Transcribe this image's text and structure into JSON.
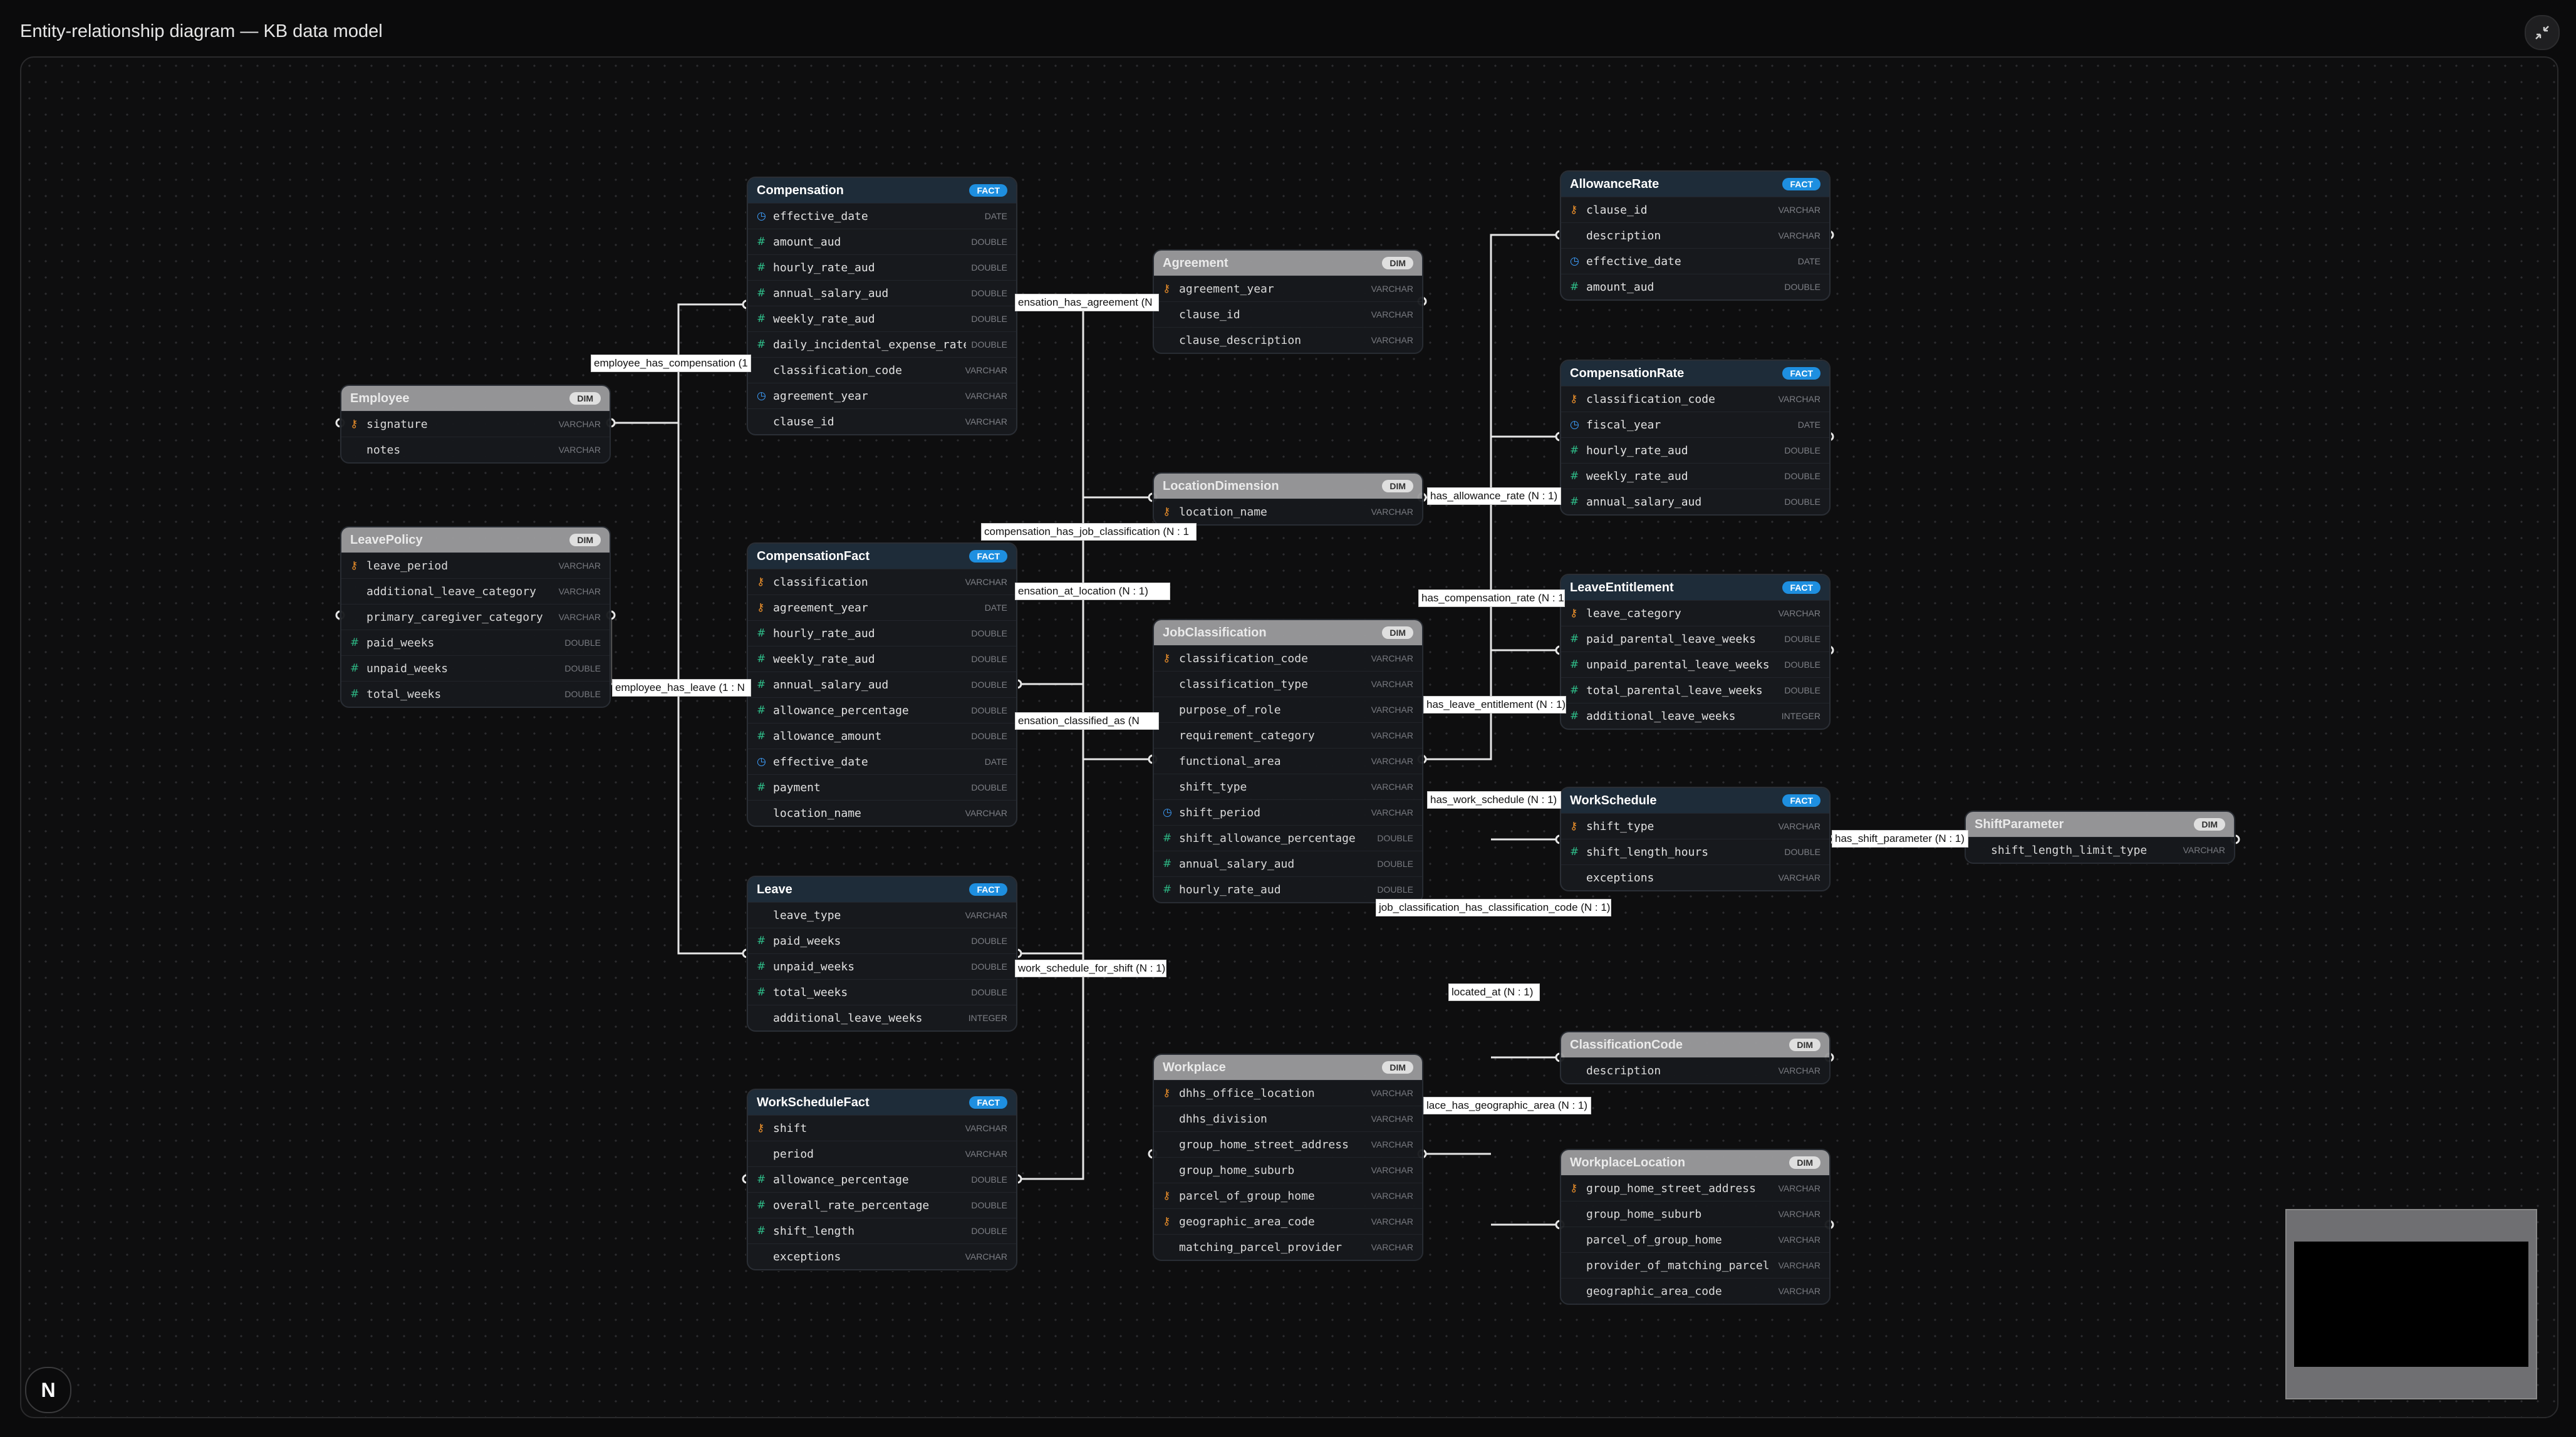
{
  "title": "Entity-relationship diagram — KB data model",
  "controls": {
    "collapse_icon": "collapse-icon",
    "logo_letter": "N"
  },
  "nodes": [
    {
      "id": "Compensation",
      "kind": "fact",
      "badge": "FACT",
      "fields": [
        {
          "icon": "date",
          "name": "effective_date",
          "type": "DATE"
        },
        {
          "icon": "num",
          "name": "amount_aud",
          "type": "DOUBLE"
        },
        {
          "icon": "num",
          "name": "hourly_rate_aud",
          "type": "DOUBLE"
        },
        {
          "icon": "num",
          "name": "annual_salary_aud",
          "type": "DOUBLE"
        },
        {
          "icon": "num",
          "name": "weekly_rate_aud",
          "type": "DOUBLE"
        },
        {
          "icon": "num",
          "name": "daily_incidental_expense_rate_",
          "type": "DOUBLE"
        },
        {
          "icon": "",
          "name": "classification_code",
          "type": "VARCHAR"
        },
        {
          "icon": "date",
          "name": "agreement_year",
          "type": "VARCHAR"
        },
        {
          "icon": "",
          "name": "clause_id",
          "type": "VARCHAR"
        }
      ]
    },
    {
      "id": "Agreement",
      "kind": "dim",
      "badge": "DIM",
      "fields": [
        {
          "icon": "key",
          "name": "agreement_year",
          "type": "VARCHAR"
        },
        {
          "icon": "",
          "name": "clause_id",
          "type": "VARCHAR"
        },
        {
          "icon": "",
          "name": "clause_description",
          "type": "VARCHAR"
        }
      ]
    },
    {
      "id": "AllowanceRate",
      "kind": "fact",
      "badge": "FACT",
      "fields": [
        {
          "icon": "key",
          "name": "clause_id",
          "type": "VARCHAR"
        },
        {
          "icon": "",
          "name": "description",
          "type": "VARCHAR"
        },
        {
          "icon": "date",
          "name": "effective_date",
          "type": "DATE"
        },
        {
          "icon": "num",
          "name": "amount_aud",
          "type": "DOUBLE"
        }
      ]
    },
    {
      "id": "Employee",
      "kind": "dim",
      "badge": "DIM",
      "fields": [
        {
          "icon": "key",
          "name": "signature",
          "type": "VARCHAR"
        },
        {
          "icon": "",
          "name": "notes",
          "type": "VARCHAR"
        }
      ]
    },
    {
      "id": "CompensationRate",
      "kind": "fact",
      "badge": "FACT",
      "fields": [
        {
          "icon": "key",
          "name": "classification_code",
          "type": "VARCHAR"
        },
        {
          "icon": "date",
          "name": "fiscal_year",
          "type": "DATE"
        },
        {
          "icon": "num",
          "name": "hourly_rate_aud",
          "type": "DOUBLE"
        },
        {
          "icon": "num",
          "name": "weekly_rate_aud",
          "type": "DOUBLE"
        },
        {
          "icon": "num",
          "name": "annual_salary_aud",
          "type": "DOUBLE"
        }
      ]
    },
    {
      "id": "LocationDimension",
      "kind": "dim",
      "badge": "DIM",
      "fields": [
        {
          "icon": "key",
          "name": "location_name",
          "type": "VARCHAR"
        }
      ]
    },
    {
      "id": "LeavePolicy",
      "kind": "dim",
      "badge": "DIM",
      "fields": [
        {
          "icon": "key",
          "name": "leave_period",
          "type": "VARCHAR"
        },
        {
          "icon": "",
          "name": "additional_leave_category",
          "type": "VARCHAR"
        },
        {
          "icon": "",
          "name": "primary_caregiver_category",
          "type": "VARCHAR"
        },
        {
          "icon": "num",
          "name": "paid_weeks",
          "type": "DOUBLE"
        },
        {
          "icon": "num",
          "name": "unpaid_weeks",
          "type": "DOUBLE"
        },
        {
          "icon": "num",
          "name": "total_weeks",
          "type": "DOUBLE"
        }
      ]
    },
    {
      "id": "CompensationFact",
      "kind": "fact",
      "badge": "FACT",
      "fields": [
        {
          "icon": "key",
          "name": "classification",
          "type": "VARCHAR"
        },
        {
          "icon": "key",
          "name": "agreement_year",
          "type": "DATE"
        },
        {
          "icon": "num",
          "name": "hourly_rate_aud",
          "type": "DOUBLE"
        },
        {
          "icon": "num",
          "name": "weekly_rate_aud",
          "type": "DOUBLE"
        },
        {
          "icon": "num",
          "name": "annual_salary_aud",
          "type": "DOUBLE"
        },
        {
          "icon": "num",
          "name": "allowance_percentage",
          "type": "DOUBLE"
        },
        {
          "icon": "num",
          "name": "allowance_amount",
          "type": "DOUBLE"
        },
        {
          "icon": "date",
          "name": "effective_date",
          "type": "DATE"
        },
        {
          "icon": "num",
          "name": "payment",
          "type": "DOUBLE"
        },
        {
          "icon": "",
          "name": "location_name",
          "type": "VARCHAR"
        }
      ]
    },
    {
      "id": "LeaveEntitlement",
      "kind": "fact",
      "badge": "FACT",
      "fields": [
        {
          "icon": "key",
          "name": "leave_category",
          "type": "VARCHAR"
        },
        {
          "icon": "num",
          "name": "paid_parental_leave_weeks",
          "type": "DOUBLE"
        },
        {
          "icon": "num",
          "name": "unpaid_parental_leave_weeks",
          "type": "DOUBLE"
        },
        {
          "icon": "num",
          "name": "total_parental_leave_weeks",
          "type": "DOUBLE"
        },
        {
          "icon": "num",
          "name": "additional_leave_weeks",
          "type": "INTEGER"
        }
      ]
    },
    {
      "id": "JobClassification",
      "kind": "dim",
      "badge": "DIM",
      "fields": [
        {
          "icon": "key",
          "name": "classification_code",
          "type": "VARCHAR"
        },
        {
          "icon": "",
          "name": "classification_type",
          "type": "VARCHAR"
        },
        {
          "icon": "",
          "name": "purpose_of_role",
          "type": "VARCHAR"
        },
        {
          "icon": "",
          "name": "requirement_category",
          "type": "VARCHAR"
        },
        {
          "icon": "",
          "name": "functional_area",
          "type": "VARCHAR"
        },
        {
          "icon": "",
          "name": "shift_type",
          "type": "VARCHAR"
        },
        {
          "icon": "date",
          "name": "shift_period",
          "type": "VARCHAR"
        },
        {
          "icon": "num",
          "name": "shift_allowance_percentage",
          "type": "DOUBLE"
        },
        {
          "icon": "num",
          "name": "annual_salary_aud",
          "type": "DOUBLE"
        },
        {
          "icon": "num",
          "name": "hourly_rate_aud",
          "type": "DOUBLE"
        }
      ]
    },
    {
      "id": "WorkSchedule",
      "kind": "fact",
      "badge": "FACT",
      "fields": [
        {
          "icon": "key",
          "name": "shift_type",
          "type": "VARCHAR"
        },
        {
          "icon": "num",
          "name": "shift_length_hours",
          "type": "DOUBLE"
        },
        {
          "icon": "",
          "name": "exceptions",
          "type": "VARCHAR"
        }
      ]
    },
    {
      "id": "ShiftParameter",
      "kind": "dim",
      "badge": "DIM",
      "fields": [
        {
          "icon": "",
          "name": "shift_length_limit_type",
          "type": "VARCHAR"
        }
      ]
    },
    {
      "id": "Leave",
      "kind": "fact",
      "badge": "FACT",
      "fields": [
        {
          "icon": "",
          "name": "leave_type",
          "type": "VARCHAR"
        },
        {
          "icon": "num",
          "name": "paid_weeks",
          "type": "DOUBLE"
        },
        {
          "icon": "num",
          "name": "unpaid_weeks",
          "type": "DOUBLE"
        },
        {
          "icon": "num",
          "name": "total_weeks",
          "type": "DOUBLE"
        },
        {
          "icon": "",
          "name": "additional_leave_weeks",
          "type": "INTEGER"
        }
      ]
    },
    {
      "id": "ClassificationCode",
      "kind": "dim",
      "badge": "DIM",
      "fields": [
        {
          "icon": "",
          "name": "description",
          "type": "VARCHAR"
        }
      ]
    },
    {
      "id": "Workplace",
      "kind": "dim",
      "badge": "DIM",
      "fields": [
        {
          "icon": "key",
          "name": "dhhs_office_location",
          "type": "VARCHAR"
        },
        {
          "icon": "",
          "name": "dhhs_division",
          "type": "VARCHAR"
        },
        {
          "icon": "",
          "name": "group_home_street_address",
          "type": "VARCHAR"
        },
        {
          "icon": "",
          "name": "group_home_suburb",
          "type": "VARCHAR"
        },
        {
          "icon": "key",
          "name": "parcel_of_group_home",
          "type": "VARCHAR"
        },
        {
          "icon": "key",
          "name": "geographic_area_code",
          "type": "VARCHAR"
        },
        {
          "icon": "",
          "name": "matching_parcel_provider",
          "type": "VARCHAR"
        }
      ]
    },
    {
      "id": "WorkScheduleFact",
      "kind": "fact",
      "badge": "FACT",
      "fields": [
        {
          "icon": "key",
          "name": "shift",
          "type": "VARCHAR"
        },
        {
          "icon": "",
          "name": "period",
          "type": "VARCHAR"
        },
        {
          "icon": "num",
          "name": "allowance_percentage",
          "type": "DOUBLE"
        },
        {
          "icon": "num",
          "name": "overall_rate_percentage",
          "type": "DOUBLE"
        },
        {
          "icon": "num",
          "name": "shift_length",
          "type": "DOUBLE"
        },
        {
          "icon": "",
          "name": "exceptions",
          "type": "VARCHAR"
        }
      ]
    },
    {
      "id": "WorkplaceLocation",
      "kind": "dim",
      "badge": "DIM",
      "fields": [
        {
          "icon": "key",
          "name": "group_home_street_address",
          "type": "VARCHAR"
        },
        {
          "icon": "",
          "name": "group_home_suburb",
          "type": "VARCHAR"
        },
        {
          "icon": "",
          "name": "parcel_of_group_home",
          "type": "VARCHAR"
        },
        {
          "icon": "",
          "name": "provider_of_matching_parcel",
          "type": "VARCHAR"
        },
        {
          "icon": "",
          "name": "geographic_area_code",
          "type": "VARCHAR"
        }
      ]
    }
  ],
  "edge_labels": [
    "employee_has_compensation (1",
    "employee_has_leave (1 : N",
    "ensation_has_agreement (N",
    "compensation_has_job_classification (N : 1",
    "ensation_at_location (N : 1)",
    "ensation_classified_as (N",
    "work_schedule_for_shift (N : 1)",
    "has_allowance_rate (N : 1)",
    "has_compensation_rate (N : 1",
    "has_leave_entitlement (N : 1)",
    "has_work_schedule (N : 1)",
    "has_shift_parameter (N : 1)",
    "job_classification_has_classification_code (N : 1)",
    "located_at (N : 1)",
    "lace_has_geographic_area (N : 1)"
  ]
}
